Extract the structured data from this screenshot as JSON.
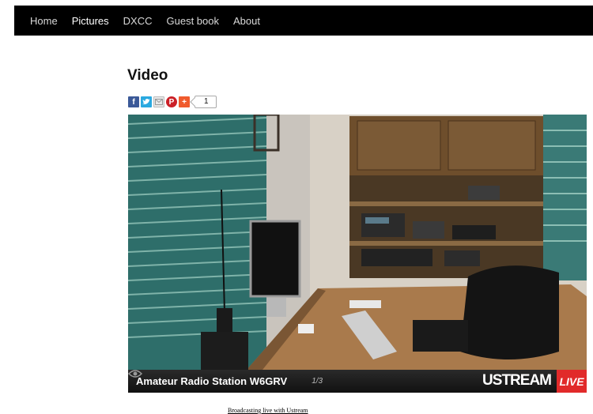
{
  "nav": {
    "items": [
      {
        "label": "Home"
      },
      {
        "label": "Pictures"
      },
      {
        "label": "DXCC"
      },
      {
        "label": "Guest book"
      },
      {
        "label": "About"
      }
    ]
  },
  "page": {
    "title": "Video"
  },
  "share": {
    "count": "1",
    "buttons": [
      "facebook-icon",
      "twitter-icon",
      "email-icon",
      "pinterest-icon",
      "plus-icon"
    ]
  },
  "video": {
    "title": "Amateur Radio Station W6GRV",
    "viewers": "1/3",
    "brand": "USTREAM",
    "live_label": "LIVE"
  },
  "footer": {
    "caption": "Broadcasting live with Ustream"
  },
  "colors": {
    "nav_bg": "#000000",
    "live_red": "#e12a2a",
    "facebook": "#3b5998",
    "twitter": "#2aa9e0",
    "pinterest": "#cb2027",
    "plus": "#f05b2d"
  }
}
